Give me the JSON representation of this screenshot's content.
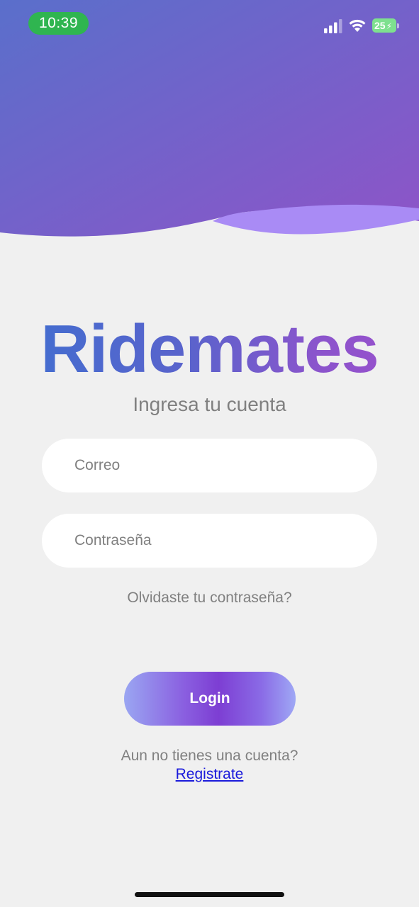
{
  "status_bar": {
    "time": "10:39",
    "battery_level": "25",
    "icons": [
      "signal-icon",
      "wifi-icon",
      "battery-charging-icon"
    ]
  },
  "brand": {
    "title": "Ridemates",
    "gradient": [
      "#3f6fd0",
      "#9b4fcd"
    ]
  },
  "login_form": {
    "subtitle": "Ingresa tu cuenta",
    "email_placeholder": "Correo",
    "password_placeholder": "Contraseña",
    "forgot_password": "Olvidaste tu contraseña?",
    "login_label": "Login"
  },
  "register": {
    "prompt": "Aun no tienes una cuenta?",
    "link_label": "Registrate"
  },
  "colors": {
    "header_start": "#5b6ccb",
    "header_end": "#8c56c9",
    "wave_light": "#a98bf5",
    "background": "#f0f0f0",
    "link": "#1a1adb"
  }
}
